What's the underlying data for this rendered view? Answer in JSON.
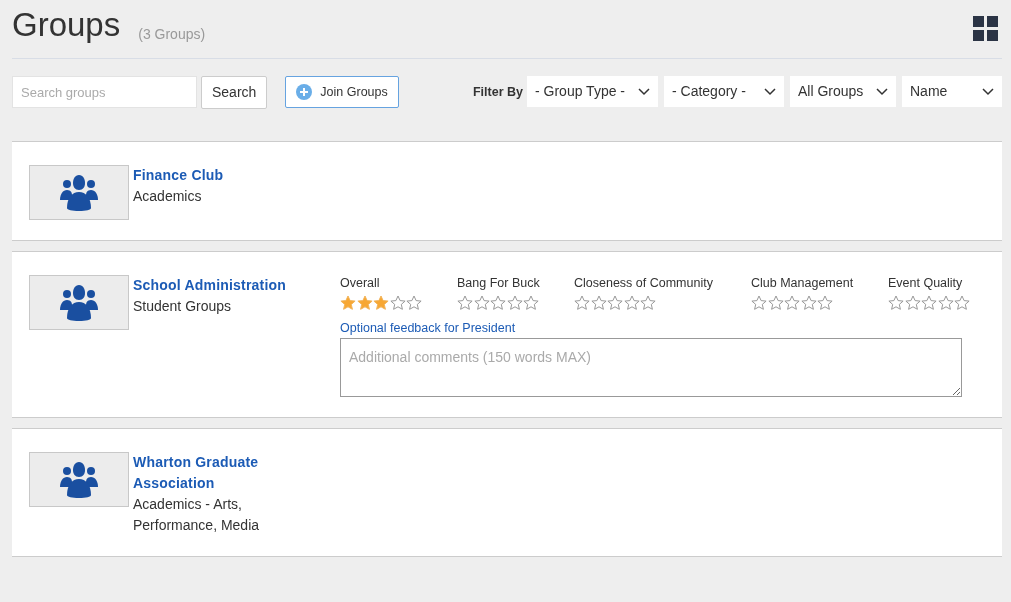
{
  "page": {
    "title": "Groups",
    "count": "(3 Groups)"
  },
  "toolbar": {
    "search": {
      "placeholder": "Search groups",
      "button": "Search"
    },
    "join_button": "Join Groups",
    "filter_label": "Filter By",
    "filters": [
      {
        "value": "- Group Type -"
      },
      {
        "value": "- Category -"
      },
      {
        "value": "All Groups"
      },
      {
        "value": "Name"
      }
    ]
  },
  "groups": [
    {
      "name": "Finance Club",
      "category": "Academics"
    },
    {
      "name": "School Administration",
      "category": "Student Groups",
      "ratings": [
        {
          "label": "Overall",
          "stars": 3
        },
        {
          "label": "Bang For Buck",
          "stars": 0
        },
        {
          "label": "Closeness of Community",
          "stars": 0
        },
        {
          "label": "Club Management",
          "stars": 0
        },
        {
          "label": "Event Quality",
          "stars": 0
        }
      ],
      "feedback": {
        "label": "Optional feedback for President",
        "placeholder": "Additional comments (150 words MAX)"
      }
    },
    {
      "name": "Wharton Graduate Association",
      "category": "Academics - Arts, Performance, Media"
    }
  ]
}
